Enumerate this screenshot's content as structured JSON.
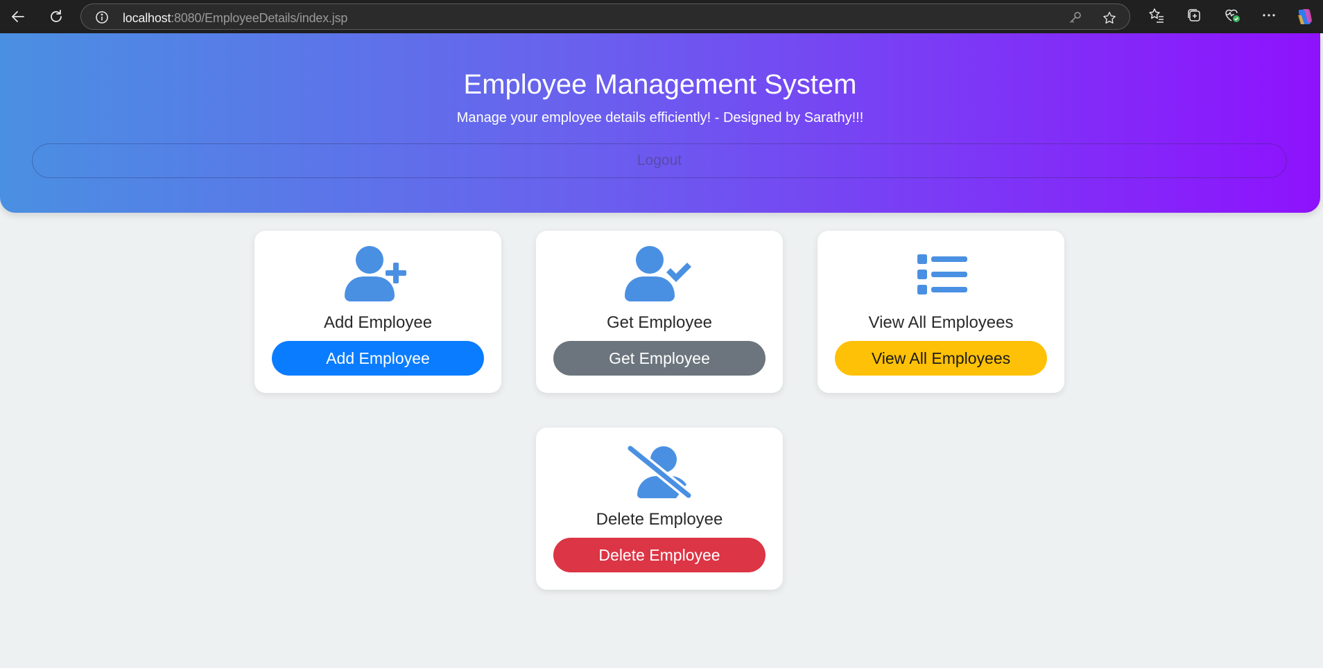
{
  "browser": {
    "url_host": "localhost",
    "url_path": ":8080/EmployeeDetails/index.jsp"
  },
  "header": {
    "title": "Employee Management System",
    "subtitle": "Manage your employee details efficiently! - Designed by Sarathy!!!",
    "logout_label": "Logout"
  },
  "cards": [
    {
      "title": "Add Employee",
      "button_label": "Add Employee",
      "button_color": "#0a7cff",
      "button_text_color": "#ffffff",
      "icon": "user-plus-icon"
    },
    {
      "title": "Get Employee",
      "button_label": "Get Employee",
      "button_color": "#6c757d",
      "button_text_color": "#ffffff",
      "icon": "user-check-icon"
    },
    {
      "title": "View All Employees",
      "button_label": "View All Employees",
      "button_color": "#ffc107",
      "button_text_color": "#1a1a1a",
      "icon": "list-icon"
    },
    {
      "title": "Delete Employee",
      "button_label": "Delete Employee",
      "button_color": "#dc3545",
      "button_text_color": "#ffffff",
      "icon": "user-slash-icon"
    }
  ],
  "colors": {
    "icon": "#4a90e2",
    "header_gradient_start": "#4a90e2",
    "header_gradient_end": "#8e12fd",
    "page_background": "#eef1f2"
  }
}
